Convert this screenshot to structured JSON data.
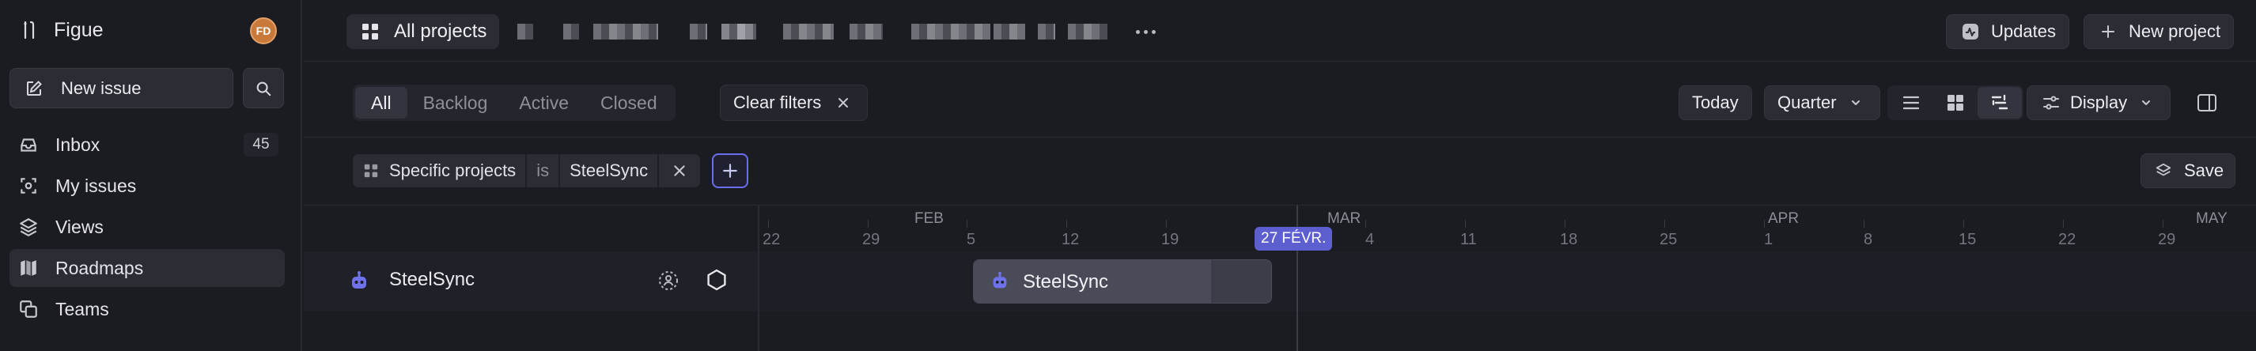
{
  "sidebar": {
    "workspace_name": "Figue",
    "avatar_initials": "FD",
    "new_issue_label": "New issue",
    "nav": [
      {
        "label": "Inbox",
        "count": "45",
        "icon": "inbox-icon"
      },
      {
        "label": "My issues",
        "icon": "my-issues-icon"
      },
      {
        "label": "Views",
        "icon": "layers-icon"
      },
      {
        "label": "Roadmaps",
        "icon": "map-icon",
        "active": true
      },
      {
        "label": "Teams",
        "icon": "teams-icon"
      }
    ]
  },
  "header": {
    "crumb": "All projects",
    "updates_label": "Updates",
    "new_project_label": "New project"
  },
  "filters": {
    "tabs": [
      "All",
      "Backlog",
      "Active",
      "Closed"
    ],
    "active_tab": "All",
    "clear_label": "Clear filters",
    "today_label": "Today",
    "zoom_label": "Quarter",
    "display_label": "Display"
  },
  "chip": {
    "field": "Specific projects",
    "operator": "is",
    "value": "SteelSync"
  },
  "save_label": "Save",
  "timeline": {
    "months": [
      "FEB",
      "MAR",
      "APR",
      "MAY"
    ],
    "days": [
      "22",
      "29",
      "5",
      "12",
      "19",
      "4",
      "11",
      "18",
      "25",
      "1",
      "8",
      "15",
      "22",
      "29"
    ],
    "today_label": "27 FÉVR.",
    "project_name": "SteelSync",
    "bar_label": "SteelSync"
  },
  "colors": {
    "accent": "#5d5fd0",
    "project_icon": "#6f72e8",
    "avatar": "#c97a3a"
  }
}
